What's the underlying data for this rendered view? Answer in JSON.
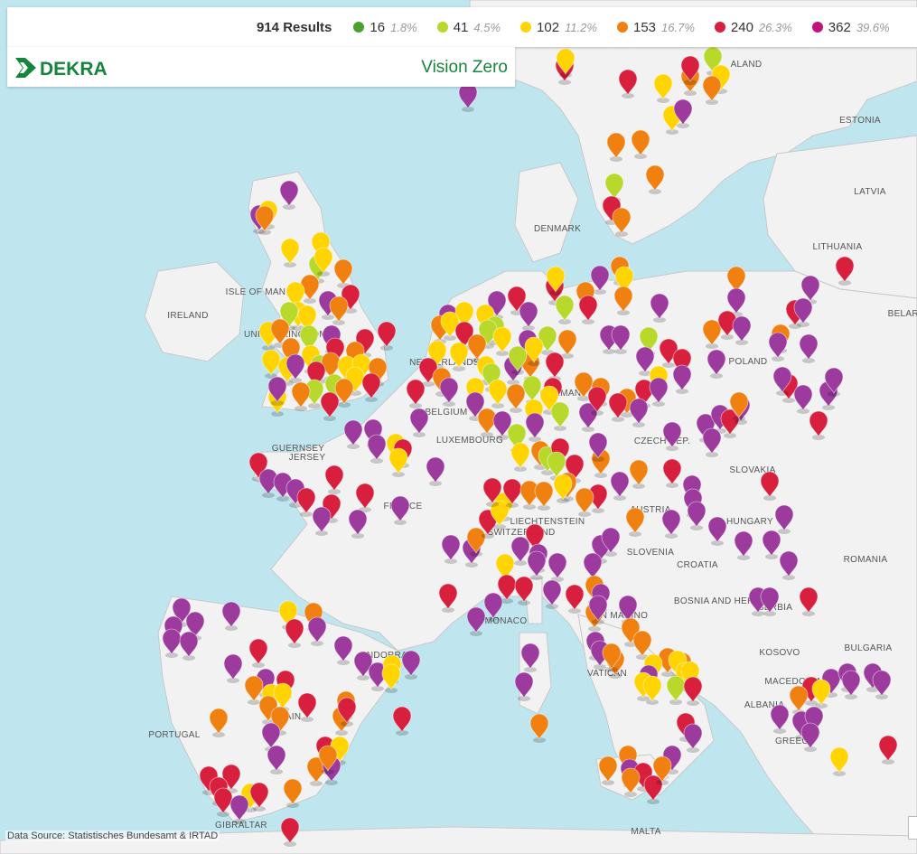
{
  "legend": {
    "results_label": "914 Results",
    "items": [
      {
        "count": "16",
        "percent": "1.8%",
        "color": "#4aa12e"
      },
      {
        "count": "41",
        "percent": "4.5%",
        "color": "#b8d92c"
      },
      {
        "count": "102",
        "percent": "11.2%",
        "color": "#ffd400"
      },
      {
        "count": "153",
        "percent": "16.7%",
        "color": "#f08010"
      },
      {
        "count": "240",
        "percent": "26.3%",
        "color": "#d91f3e"
      },
      {
        "count": "362",
        "percent": "39.6%",
        "color": "#c0147c"
      }
    ]
  },
  "brand": {
    "logo_text": "DEKRA",
    "tagline": "Vision Zero",
    "logo_color": "#15843c"
  },
  "data_source": "Data Source: Statistisches Bundesamt & IRTAD",
  "map": {
    "water_color": "#bfe6ef",
    "land_color": "#f2f2f2",
    "labels": [
      "ALAND",
      "ESTONIA",
      "LATVIA",
      "LITHUANIA",
      "DENMARK",
      "IRELAND",
      "ISLE OF MAN",
      "UNITED KINGDOM",
      "BELGIUM",
      "LUXEMBOURG",
      "GERMANY",
      "POLAND",
      "CZECH REP.",
      "SLOVAKIA",
      "FRANCE",
      "GUERNSEY",
      "JERSEY",
      "AUSTRIA",
      "HUNGARY",
      "LIECHTENSTEIN",
      "SWITZERLAND",
      "SLOVENIA",
      "CROATIA",
      "ROMANIA",
      "BOSNIA AND HERZ.",
      "SERBIA",
      "BULGARIA",
      "KOSOVO",
      "MACEDONIA",
      "ALBANIA",
      "GREECE",
      "MONACO",
      "SAN MARINO",
      "VATICAN",
      "ANDORRA",
      "PORTUGAL",
      "SPAIN",
      "GIBRALTAR",
      "MALTA",
      "NETHERLANDS",
      "BELARUS"
    ],
    "marker_colors": {
      "green": "#4aa12e",
      "lime": "#b8d92c",
      "yellow": "#ffd400",
      "orange": "#f08010",
      "red": "#d91f3e",
      "purple": "#9c3a9e"
    }
  }
}
